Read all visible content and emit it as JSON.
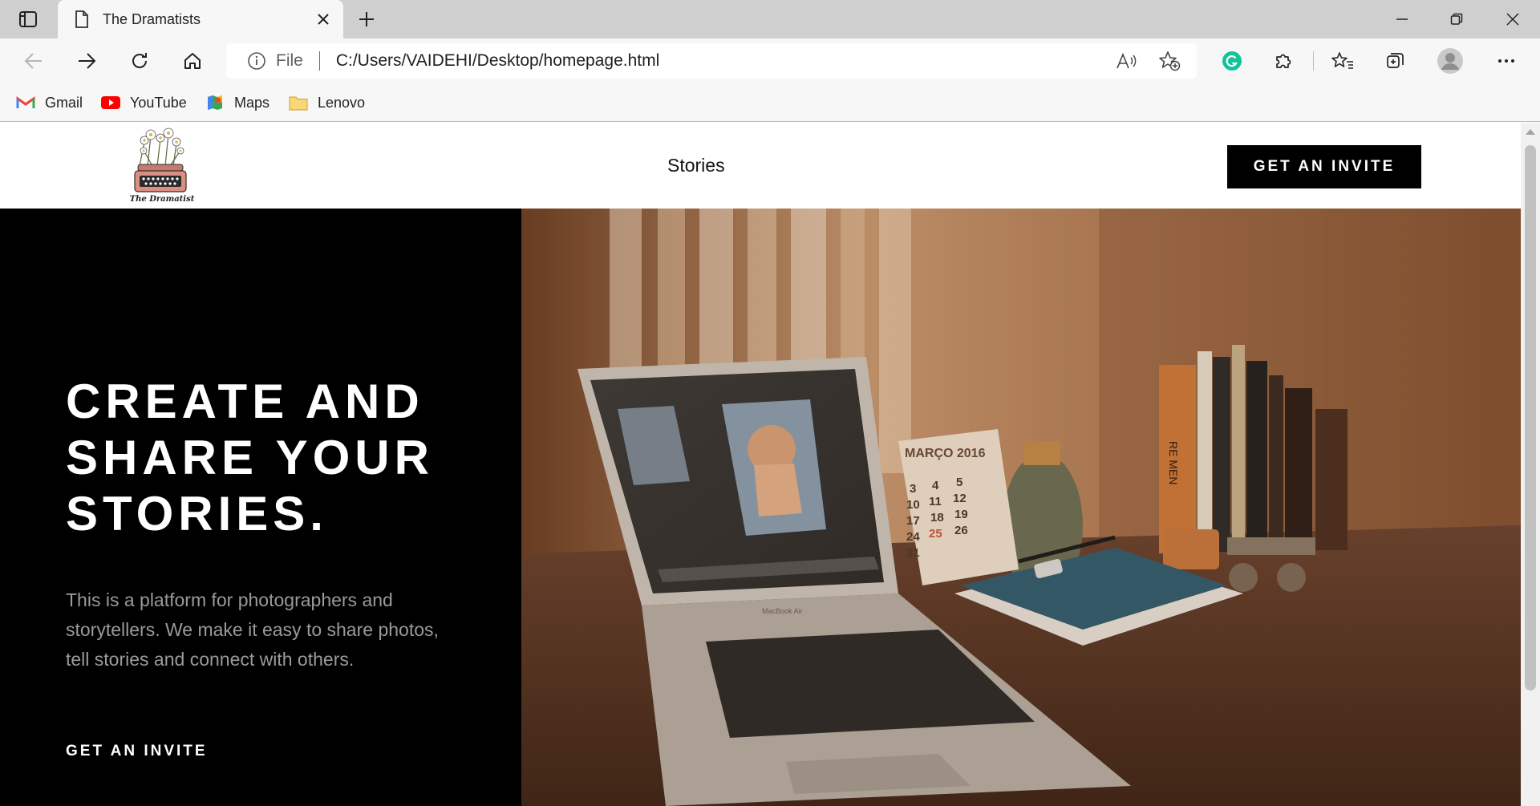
{
  "browser": {
    "tab_title": "The Dramatists",
    "address_scheme": "File",
    "address_url": "C:/Users/VAIDEHI/Desktop/homepage.html",
    "bookmarks": [
      {
        "label": "Gmail",
        "icon": "gmail-icon"
      },
      {
        "label": "YouTube",
        "icon": "youtube-icon"
      },
      {
        "label": "Maps",
        "icon": "maps-icon"
      },
      {
        "label": "Lenovo",
        "icon": "folder-icon"
      }
    ]
  },
  "site": {
    "logo_caption": "The Dramatist",
    "nav_link": "Stories",
    "header_cta": "GET AN INVITE"
  },
  "hero": {
    "title_lines": [
      "CREATE AND",
      "SHARE YOUR",
      "STORIES."
    ],
    "description": "This is a platform for photographers and storytellers. We make it easy to share photos, tell stories and connect with others.",
    "cta": "GET AN INVITE"
  },
  "photo": {
    "calendar_month": "MARÇO 2016",
    "calendar_days": [
      "3",
      "4",
      "5",
      "10",
      "11",
      "12",
      "17",
      "18",
      "19",
      "24",
      "25",
      "26",
      "31"
    ],
    "laptop_label": "MacBook Air",
    "book_spine": "RE MEN"
  },
  "colors": {
    "accent": "#000000",
    "tabbar": "#cfcfcf",
    "toolbar": "#f7f7f7",
    "hero_text_muted": "#9a9a9a"
  }
}
